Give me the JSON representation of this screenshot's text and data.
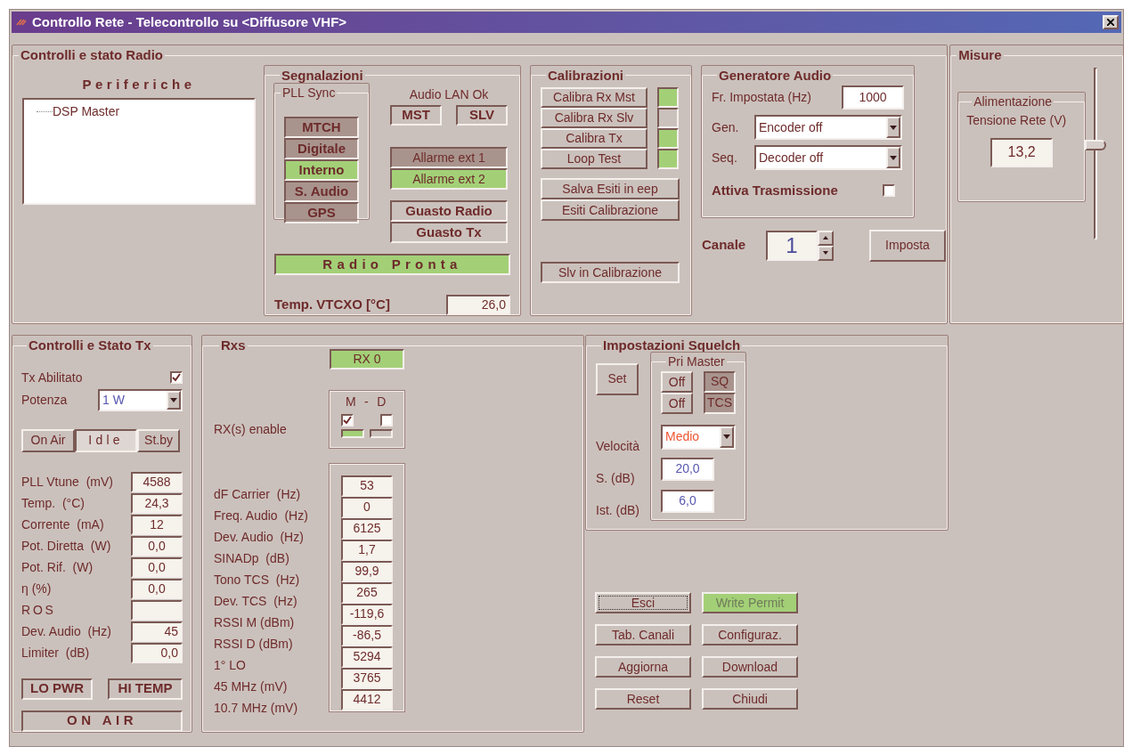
{
  "window": {
    "title": "Controllo Rete - Telecontrollo su <Diffusore VHF>"
  },
  "radio": {
    "title": "Controlli e stato Radio",
    "peripherals": {
      "title": "Periferiche",
      "items": [
        {
          "label": "DSP Master"
        }
      ]
    },
    "signals": {
      "title": "Segnalazioni",
      "pll": {
        "title": "PLL Sync",
        "items": [
          {
            "label": "MTCH",
            "on": false
          },
          {
            "label": "Digitale",
            "on": false
          },
          {
            "label": "Interno",
            "on": true
          },
          {
            "label": "S. Audio",
            "on": false
          },
          {
            "label": "GPS",
            "on": false
          }
        ]
      },
      "audio_lan": {
        "title": "Audio LAN Ok",
        "items": [
          {
            "label": "MST"
          },
          {
            "label": "SLV"
          }
        ]
      },
      "alarms": [
        {
          "label": "Allarme ext 1",
          "on": false
        },
        {
          "label": "Allarme ext 2",
          "on": true
        }
      ],
      "faults": [
        {
          "label": "Guasto Radio"
        },
        {
          "label": "Guasto Tx"
        }
      ],
      "radio_ready": {
        "label": "Radio Pronta",
        "on": true
      },
      "vtcxo": {
        "label": "Temp. VTCXO [°C]",
        "value": "26,0"
      }
    },
    "calibrations": {
      "title": "Calibrazioni",
      "items": [
        {
          "label": "Calibra Rx Mst",
          "ok": true
        },
        {
          "label": "Calibra Rx Slv",
          "ok": false
        },
        {
          "label": "Calibra Tx",
          "ok": true
        },
        {
          "label": "Loop Test",
          "ok": true
        }
      ],
      "buttons": [
        "Salva Esiti in eep",
        "Esiti Calibrazione"
      ],
      "slave_status": "Slv in Calibrazione"
    },
    "generator": {
      "title": "Generatore Audio",
      "freq_label": "Fr. Impostata  (Hz)",
      "freq_value": "1000",
      "gen_label": "Gen.",
      "gen_value": "Encoder off",
      "seq_label": "Seq.",
      "seq_value": "Decoder off",
      "transmit_label": "Attiva Trasmissione",
      "transmit_checked": false
    },
    "channel": {
      "label": "Canale",
      "value": "1",
      "button": "Imposta"
    }
  },
  "measures": {
    "title": "Misure",
    "group_title": "Alimentazione",
    "label": "Tensione Rete (V)",
    "value": "13,2",
    "slider": {
      "level": 0.55
    }
  },
  "tx": {
    "title": "Controlli e Stato Tx",
    "enabled_label": "Tx Abilitato",
    "enabled": true,
    "power_label": "Potenza",
    "power_value": "1 W",
    "modes": [
      {
        "label": "On Air",
        "selected": false
      },
      {
        "label": "Idle",
        "selected": true
      },
      {
        "label": "St.by",
        "selected": false
      }
    ],
    "readings": [
      {
        "label": "PLL Vtune  (mV)",
        "value": "4588",
        "right_aligned": false
      },
      {
        "label": "Temp.  (°C)",
        "value": "24,3",
        "right_aligned": false
      },
      {
        "label": "Corrente  (mA)",
        "value": "12",
        "right_aligned": false
      },
      {
        "label": "Pot. Diretta  (W)",
        "value": "0,0",
        "right_aligned": false
      },
      {
        "label": "Pot. Rif.  (W)",
        "value": "0,0",
        "right_aligned": false
      },
      {
        "label": "η (%)",
        "value": "0,0",
        "right_aligned": false
      },
      {
        "label": "ROS"
      },
      {
        "label": "Dev. Audio  (Hz)",
        "value": "45",
        "right_aligned": true
      },
      {
        "label": "Limiter  (dB)",
        "value": "0,0",
        "right_aligned": true
      }
    ],
    "flags": [
      "LO PWR",
      "HI TEMP"
    ],
    "on_air": "ON AIR"
  },
  "rxs": {
    "title": "Rxs",
    "rx_badge": {
      "label": "RX 0",
      "on": true
    },
    "enable_label": "RX(s) enable",
    "md_label": "M - D",
    "enable": [
      {
        "checked": true,
        "on": true
      },
      {
        "checked": false,
        "on": false
      }
    ],
    "readings": [
      {
        "label": "dF Carrier  (Hz)",
        "value": "53"
      },
      {
        "label": "Freq. Audio  (Hz)",
        "value": "0"
      },
      {
        "label": "Dev. Audio  (Hz)",
        "value": "6125"
      },
      {
        "label": "SINADp  (dB)",
        "value": "1,7"
      },
      {
        "label": "Tono TCS  (Hz)",
        "value": "99,9"
      },
      {
        "label": "Dev. TCS  (Hz)",
        "value": "265"
      },
      {
        "label": "RSSI M (dBm)",
        "value": "-119,6"
      },
      {
        "label": "RSSI D (dBm)",
        "value": "-86,5"
      },
      {
        "label": "1° LO",
        "value": "5294"
      },
      {
        "label": "45 MHz (mV)",
        "value": "3765"
      },
      {
        "label": "10.7 MHz (mV)",
        "value": "4412"
      }
    ]
  },
  "squelch": {
    "title": "Impostazioni Squelch",
    "set_button": "Set",
    "group_title": "Pri Master",
    "rows": [
      {
        "button": "Off",
        "indicator": "SQ",
        "on": false
      },
      {
        "button": "Off",
        "indicator": "TCS",
        "on": false
      }
    ],
    "speed_label": "Velocità",
    "speed_value": "Medio",
    "s_label": "S. (dB)",
    "s_value": "20,0",
    "ist_label": "Ist. (dB)",
    "ist_value": "6,0"
  },
  "buttons": [
    {
      "label": "Esci",
      "kind": "button",
      "focused": true
    },
    {
      "label": "Write Permit",
      "kind": "lamp",
      "focused": false
    },
    {
      "label": "Tab. Canali",
      "kind": "button",
      "focused": false
    },
    {
      "label": "Configuraz.",
      "kind": "button",
      "focused": false
    },
    {
      "label": "Aggiorna",
      "kind": "button",
      "focused": false
    },
    {
      "label": "Download",
      "kind": "button",
      "focused": false
    },
    {
      "label": "Reset",
      "kind": "button",
      "focused": false
    },
    {
      "label": "Chiudi",
      "kind": "button",
      "focused": false
    }
  ]
}
